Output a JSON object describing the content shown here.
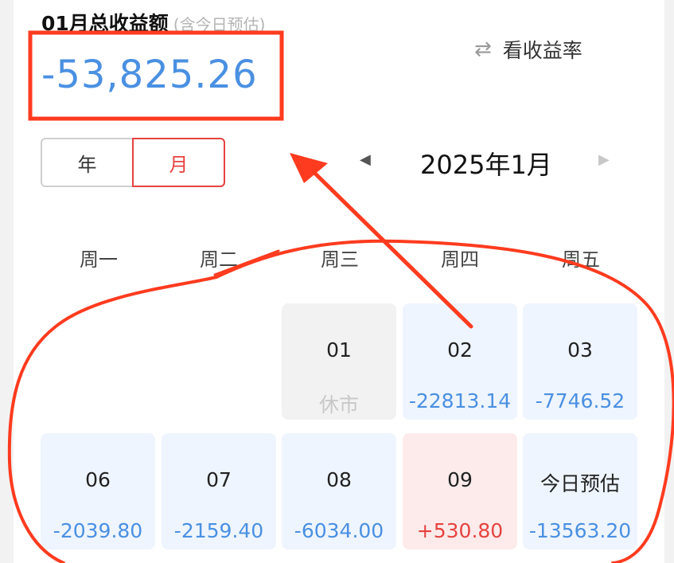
{
  "header": {
    "title": "01月总收益额",
    "title_note": "(含今日预估)",
    "total": "-53,825.26",
    "rate_toggle_icon": "swap-arrows-icon",
    "rate_toggle_label": "看收益率"
  },
  "period_toggle": {
    "year_label": "年",
    "month_label": "月",
    "selected": "月"
  },
  "month_nav": {
    "label": "2025年1月"
  },
  "weekdays": [
    "周一",
    "周二",
    "周三",
    "周四",
    "周五"
  ],
  "calendar": [
    {
      "day": "01",
      "value": "休市",
      "status": "closed"
    },
    {
      "day": "02",
      "value": "-22813.14",
      "status": "loss"
    },
    {
      "day": "03",
      "value": "-7746.52",
      "status": "loss"
    },
    {
      "day": "06",
      "value": "-2039.80",
      "status": "loss"
    },
    {
      "day": "07",
      "value": "-2159.40",
      "status": "loss"
    },
    {
      "day": "08",
      "value": "-6034.00",
      "status": "loss"
    },
    {
      "day": "09",
      "value": "+530.80",
      "status": "gain"
    },
    {
      "day": "今日预估",
      "value": "-13563.20",
      "status": "loss"
    }
  ],
  "colors": {
    "loss": "#4a90e2",
    "gain": "#e64340",
    "annotation": "#ff3b1f"
  }
}
